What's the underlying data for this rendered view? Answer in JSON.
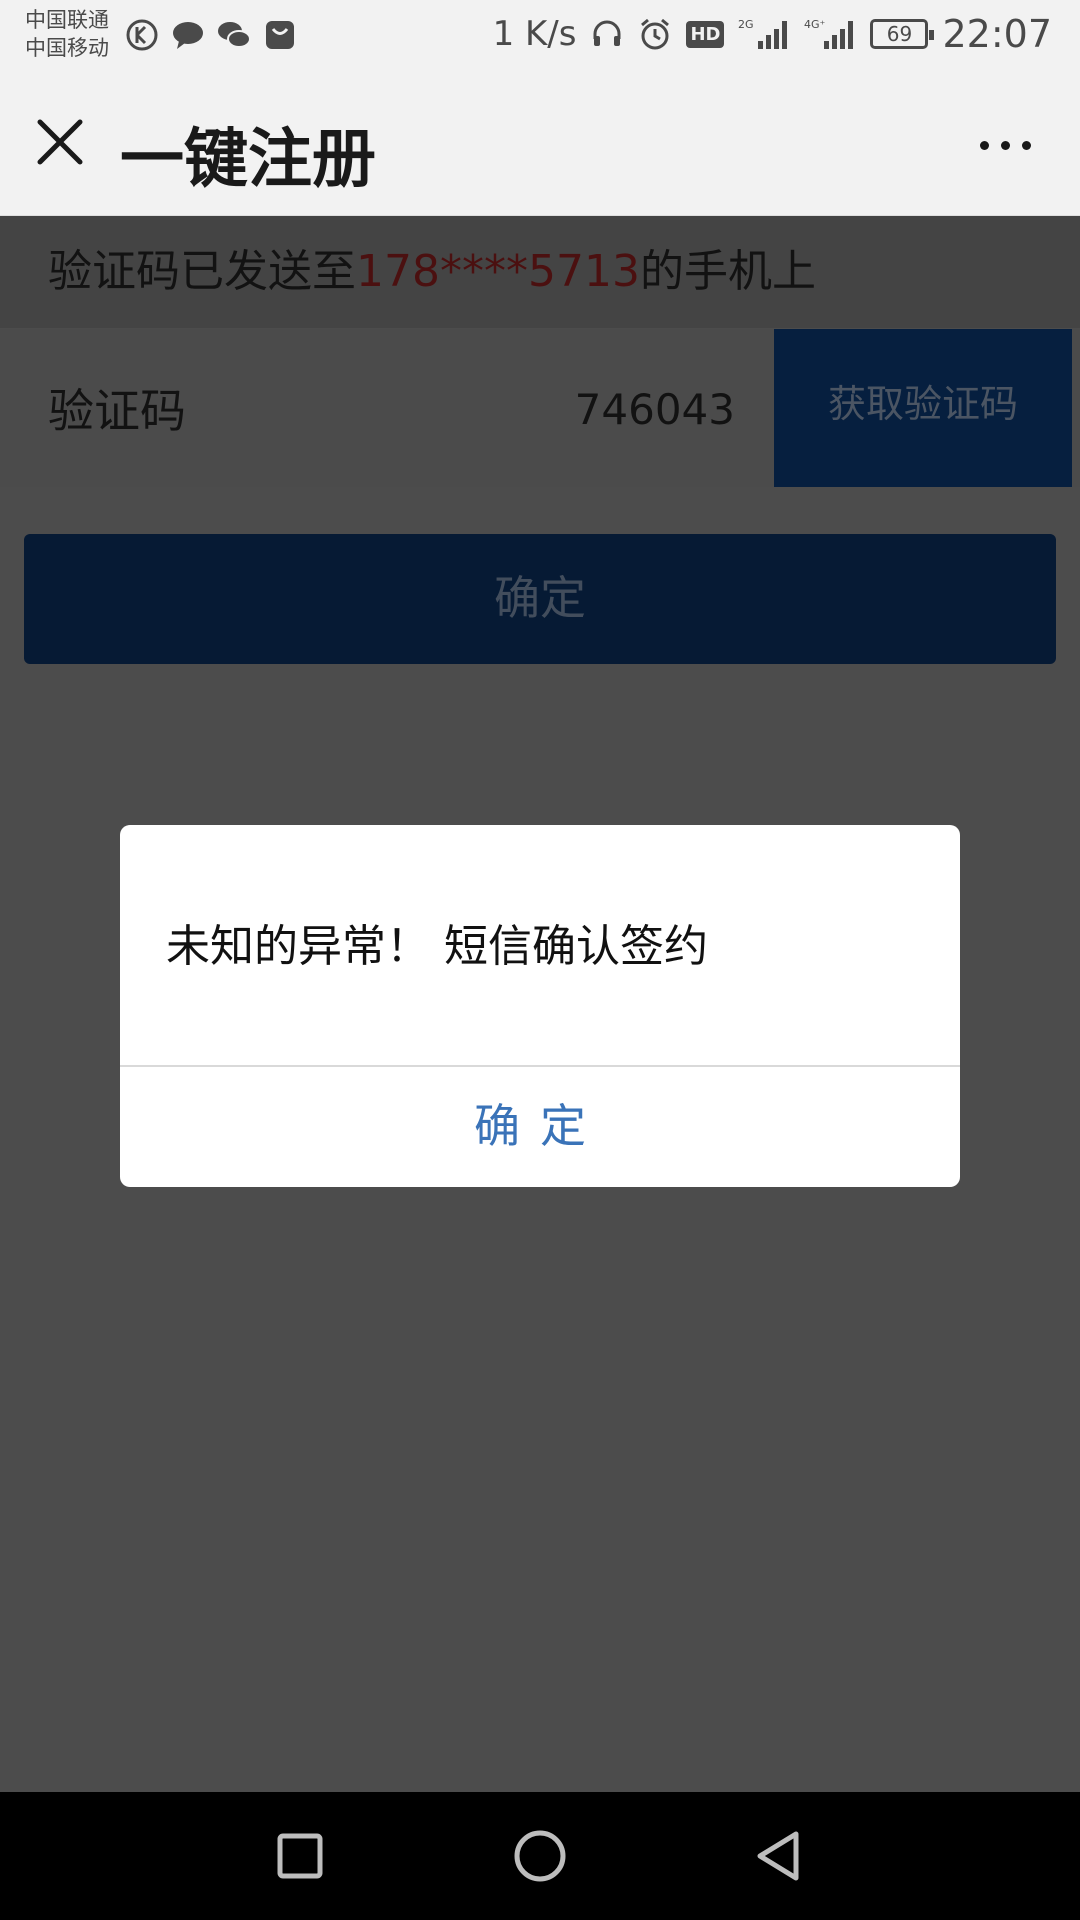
{
  "status_bar": {
    "carrier_1": "中国联通",
    "carrier_2": "中国移动",
    "net_speed": "1 K/s",
    "hd": "HD",
    "network_1": "2G",
    "network_2": "4G⁺",
    "battery": "69",
    "time": "22:07",
    "icons": [
      "k-app-icon",
      "chat-bubble-icon",
      "wechat-icon",
      "huawei-store-icon",
      "headset-icon",
      "alarm-icon",
      "signal-icon",
      "signal-icon",
      "battery-icon"
    ]
  },
  "header": {
    "title": "一键注册",
    "close_icon": "close-icon",
    "more_icon": "more-icon"
  },
  "form": {
    "sent_prefix": "验证码已发送至",
    "phone_masked": "178****5713",
    "sent_suffix": "的手机上",
    "code_label": "验证码",
    "code_value": "746043",
    "get_code_label": "获取验证码",
    "confirm_label": "确定"
  },
  "dialog": {
    "message": "未知的异常！ 短信确认签约",
    "ok_label": "确定"
  },
  "nav": {
    "icons": [
      "recent-apps-icon",
      "home-icon",
      "back-icon"
    ]
  },
  "colors": {
    "accent_blue": "#3a73b8",
    "button_navy": "#0a3366",
    "phone_red": "#7a1a1a"
  }
}
